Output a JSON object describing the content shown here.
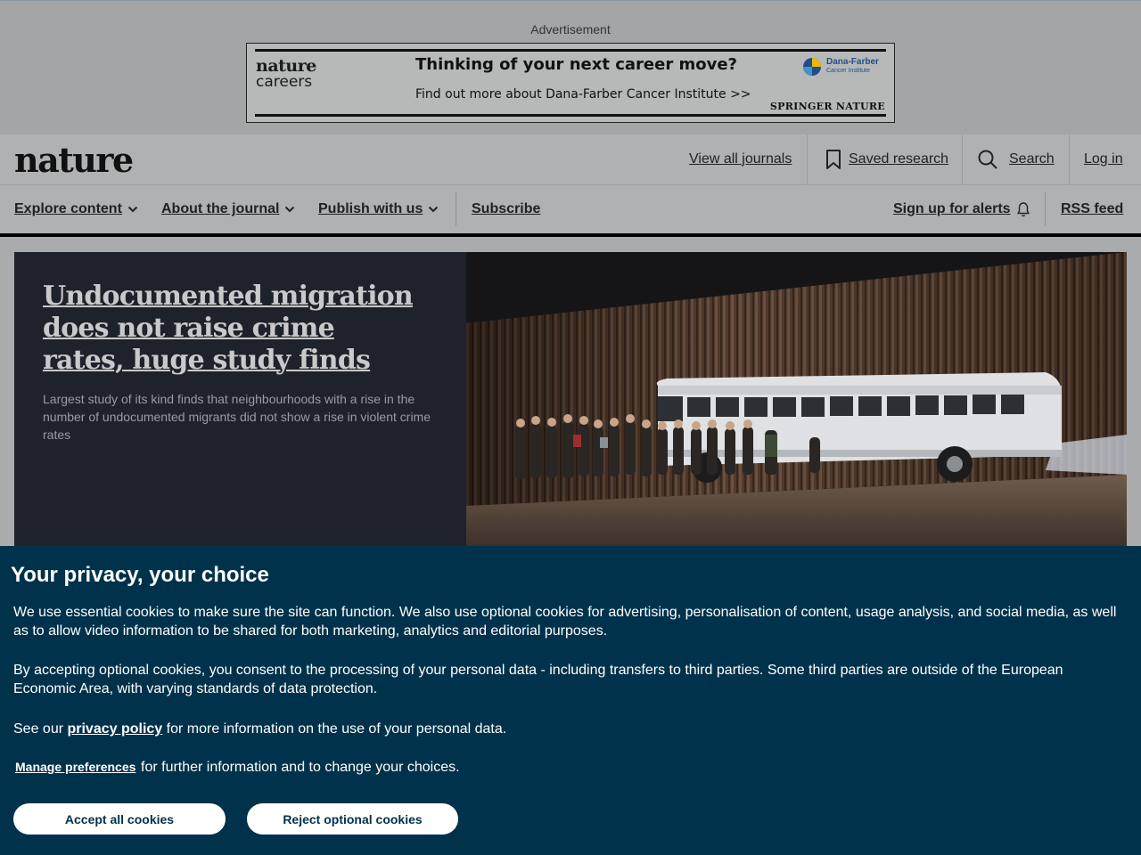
{
  "ad": {
    "label": "Advertisement",
    "logo_line1": "nature",
    "logo_line2": "careers",
    "headline": "Thinking of your next career move?",
    "subline": "Find out more about Dana-Farber Cancer Institute >>",
    "sponsor_name": "Dana-Farber",
    "sponsor_sub": "Cancer Institute",
    "publisher": "SPRINGER NATURE"
  },
  "header": {
    "logo": "nature",
    "view_all_journals": "View all journals",
    "saved_research": "Saved research",
    "search": "Search",
    "login": "Log in"
  },
  "nav": {
    "explore_content": "Explore content",
    "about_journal": "About the journal",
    "publish_with_us": "Publish with us",
    "subscribe": "Subscribe",
    "sign_up_alerts": "Sign up for alerts",
    "rss_feed": "RSS feed"
  },
  "hero": {
    "title": "Undocumented migration does not raise crime rates, huge study finds",
    "description": "Largest study of its kind finds that neighbourhoods with a rise in the number of undocumented migrants did not show a rise in violent crime rates"
  },
  "cookie": {
    "title": "Your privacy, your choice",
    "p1": "We use essential cookies to make sure the site can function. We also use optional cookies for advertising, personalisation of content, usage analysis, and social media, as well as to allow video information to be shared for both marketing, analytics and editorial purposes.",
    "p2": "By accepting optional cookies, you consent to the processing of your personal data - including transfers to third parties. Some third parties are outside of the European Economic Area, with varying standards of data protection.",
    "p3_before": "See our ",
    "p3_link": "privacy policy",
    "p3_after": " for more information on the use of your personal data.",
    "manage_link": "Manage preferences",
    "manage_rest": "for further information and to change your choices.",
    "accept_button": "Accept all cookies",
    "reject_button": "Reject optional cookies"
  }
}
